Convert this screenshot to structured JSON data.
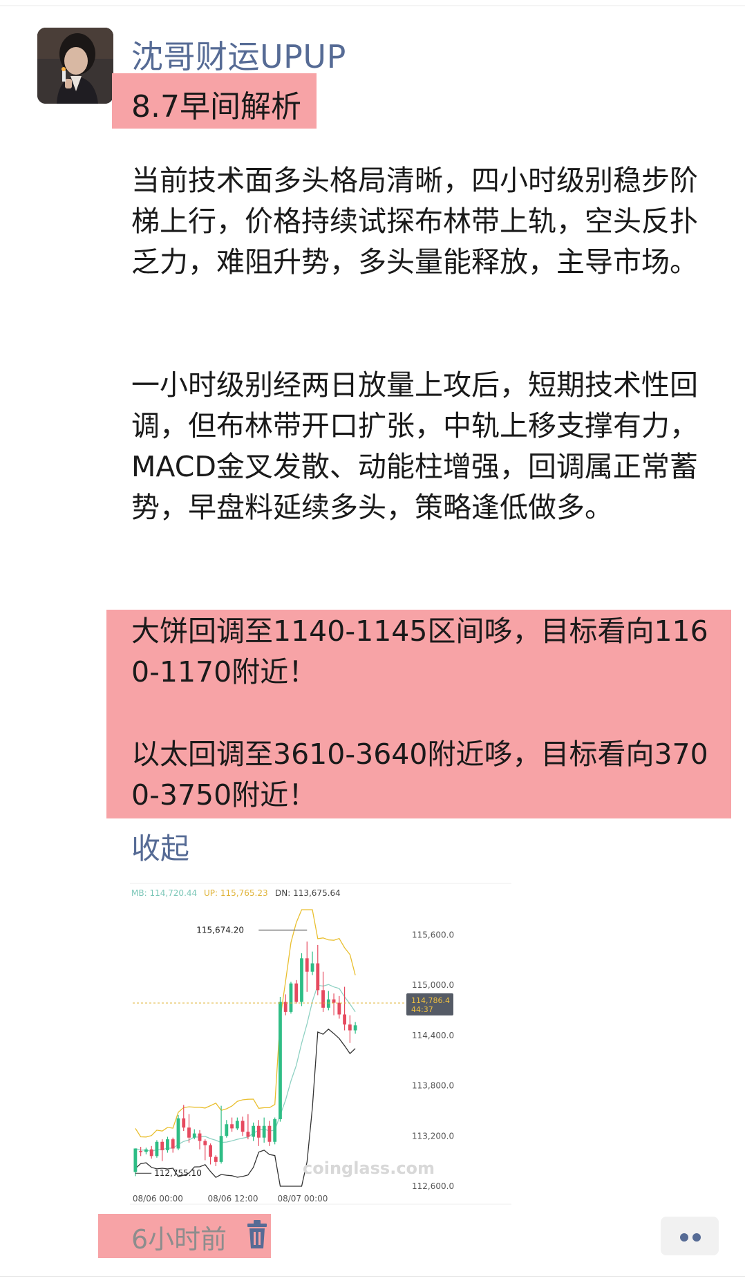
{
  "post": {
    "username": "沈哥财运UPUP",
    "title": "8.7早间解析",
    "paragraphs": [
      "当前技术面多头格局清晰，四小时级别稳步阶梯上行，价格持续试探布林带上轨，空头反扑乏力，难阻升势，多头量能释放，主导市场。",
      "一小时级别经两日放量上攻后，短期技术性回调，但布林带开口扩张，中轨上移支撑有力，MACD金叉发散、动能柱增强，回调属正常蓄势，早盘料延续多头，策略逢低做多。"
    ],
    "highlight_paragraphs": [
      "大饼回调至1140-1145区间哆，目标看向1160-1170附近！",
      "以太回调至3610-3640附近哆，目标看向3700-3750附近！"
    ],
    "collapse_label": "收起",
    "time": "6小时前",
    "highlight_color": "#f7a3a6",
    "link_color": "#566b95"
  },
  "chart_data": {
    "type": "candlestick",
    "legend": {
      "mb_label": "MB: 114,720.44",
      "up_label": "UP: 115,765.23",
      "dn_label": "DN: 113,675.64"
    },
    "y_ticks": [
      "115,600.0",
      "115,000.0",
      "114,400.0",
      "113,800.0",
      "113,200.0",
      "112,600.0"
    ],
    "x_ticks": [
      "08/06 00:00",
      "08/06 12:00",
      "08/07 00:00"
    ],
    "ylim": [
      112600,
      115900
    ],
    "high_label": "115,674.20",
    "low_label": "112,755.10",
    "current_price": "114,786.4",
    "countdown": "44:37",
    "watermark": "coinglass.com",
    "colors": {
      "up": "#2ebd85",
      "down": "#e64a5f",
      "upper_band": "#e9bf2f",
      "mid_band": "#8fd1c3",
      "lower_band": "#333333"
    },
    "candles": [
      [
        112770,
        113050,
        112720,
        113020
      ],
      [
        113020,
        113010,
        112960,
        113070
      ],
      [
        113010,
        113040,
        112980,
        113060
      ],
      [
        113040,
        112960,
        112930,
        113080
      ],
      [
        112960,
        113130,
        112940,
        113150
      ],
      [
        113130,
        113030,
        112900,
        113160
      ],
      [
        113030,
        113160,
        113000,
        113190
      ],
      [
        113160,
        113050,
        113000,
        113180
      ],
      [
        113050,
        113410,
        113030,
        113450
      ],
      [
        113410,
        113300,
        113260,
        113570
      ],
      [
        113300,
        113180,
        113120,
        113460
      ],
      [
        113180,
        113230,
        113160,
        113280
      ],
      [
        113230,
        113140,
        113040,
        113270
      ],
      [
        113140,
        113090,
        112910,
        113160
      ],
      [
        113090,
        112950,
        112860,
        113110
      ],
      [
        112950,
        112890,
        112840,
        112970
      ],
      [
        112890,
        113200,
        112870,
        113560
      ],
      [
        113200,
        113340,
        113180,
        113390
      ],
      [
        113340,
        113290,
        113250,
        113420
      ],
      [
        113290,
        113380,
        113270,
        113420
      ],
      [
        113380,
        113250,
        113200,
        113430
      ],
      [
        113250,
        113190,
        113160,
        113460
      ],
      [
        113190,
        113320,
        113140,
        113360
      ],
      [
        113320,
        113180,
        113080,
        113390
      ],
      [
        113180,
        113320,
        113120,
        113420
      ],
      [
        113320,
        113130,
        113080,
        113380
      ],
      [
        113130,
        113400,
        113100,
        113420
      ],
      [
        113400,
        114800,
        113370,
        114860
      ],
      [
        114800,
        114680,
        114640,
        114890
      ],
      [
        114680,
        115020,
        114660,
        115040
      ],
      [
        115020,
        114800,
        114780,
        115060
      ],
      [
        114800,
        115320,
        114750,
        115380
      ],
      [
        115320,
        115160,
        114920,
        115520
      ],
      [
        115160,
        115260,
        115120,
        115400
      ],
      [
        115260,
        114940,
        114880,
        115480
      ],
      [
        114940,
        114730,
        114680,
        115160
      ],
      [
        114730,
        114830,
        114700,
        114930
      ],
      [
        114830,
        114790,
        114640,
        114900
      ],
      [
        114790,
        114650,
        114600,
        114870
      ],
      [
        114650,
        114530,
        114460,
        114980
      ],
      [
        114530,
        114460,
        114310,
        114640
      ],
      [
        114460,
        114520,
        114420,
        114560
      ]
    ]
  }
}
